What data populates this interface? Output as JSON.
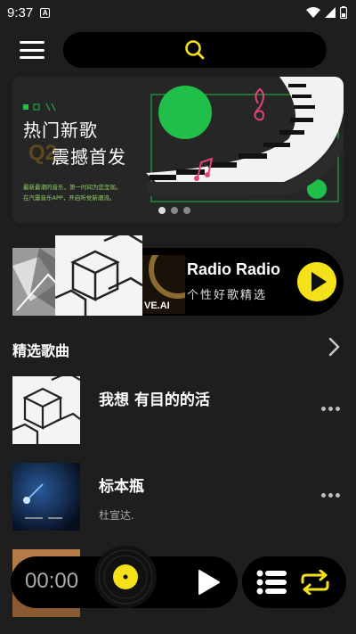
{
  "status_bar": {
    "time": "9:37",
    "app_icon_letter": "A"
  },
  "search": {
    "icon": "search-icon",
    "icon_color": "#f5e11a"
  },
  "banner": {
    "title_line1": "热门新歌",
    "title_line2": "震撼首发",
    "background_letters": "Q2",
    "desc_line1": "最新最潮的音乐，第一时间为您呈现。",
    "desc_line2": "在汽震音乐APP，开启听觉新潮流。",
    "page_count": 3,
    "active_page": 1,
    "accent_color": "#1fbf4a"
  },
  "radio": {
    "title": "Radio Radio",
    "subtitle": "个性好歌精选",
    "cover3_text": "VE.AI",
    "play_color": "#f5e11a"
  },
  "section": {
    "title": "精选歌曲"
  },
  "songs": [
    {
      "title": "我想 有目的的活",
      "artist": ""
    },
    {
      "title": "标本瓶",
      "artist": "杜宣达."
    },
    {
      "title": "",
      "artist": ""
    }
  ],
  "player": {
    "time": "00:00",
    "disc_color": "#f5e11a"
  },
  "colors": {
    "accent": "#f5e11a",
    "background": "#1e1e1e"
  }
}
